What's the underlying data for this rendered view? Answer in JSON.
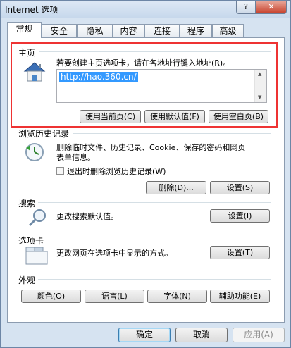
{
  "window": {
    "title": "Internet 选项",
    "help_label": "?",
    "close_label": "✕"
  },
  "tabs": [
    "常规",
    "安全",
    "隐私",
    "内容",
    "连接",
    "程序",
    "高级"
  ],
  "homepage": {
    "title": "主页",
    "hint": "若要创建主页选项卡，请在各地址行键入地址(R)。",
    "address": "http://hao.360.cn/",
    "use_current": "使用当前页(C)",
    "use_default": "使用默认值(F)",
    "use_blank": "使用空白页(B)"
  },
  "history": {
    "title": "浏览历史记录",
    "desc_line1": "删除临时文件、历史记录、Cookie、保存的密码和网页",
    "desc_line2": "表单信息。",
    "checkbox_label": "退出时删除浏览历史记录(W)",
    "delete_button": "删除(D)...",
    "settings_button": "设置(S)"
  },
  "search": {
    "title": "搜索",
    "desc": "更改搜索默认值。",
    "settings_button": "设置(I)"
  },
  "tabsgroup": {
    "title": "选项卡",
    "desc": "更改网页在选项卡中显示的方式。",
    "settings_button": "设置(T)"
  },
  "appearance": {
    "title": "外观",
    "colors": "颜色(O)",
    "languages": "语言(L)",
    "fonts": "字体(N)",
    "accessibility": "辅助功能(E)"
  },
  "footer": {
    "ok": "确定",
    "cancel": "取消",
    "apply": "应用(A)"
  },
  "colors": {
    "selection": "#3399ff",
    "highlight_box": "#ee3333"
  }
}
